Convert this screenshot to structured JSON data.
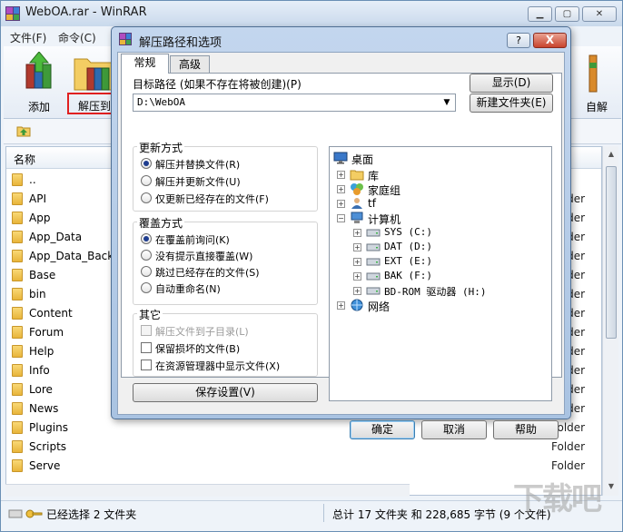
{
  "main_window": {
    "title": "WebOA.rar - WinRAR",
    "menu": [
      "文件(F)",
      "命令(C)"
    ],
    "toolbar": {
      "add_label": "添加",
      "extract_label": "解压到",
      "wizard_label": "自解"
    },
    "columns": {
      "name": "名称"
    },
    "files": [
      {
        "name": "..",
        "type": ""
      },
      {
        "name": "API",
        "type": "Folder"
      },
      {
        "name": "App",
        "type": "Folder"
      },
      {
        "name": "App_Data",
        "type": "Folder"
      },
      {
        "name": "App_Data_Backu",
        "type": "Folder"
      },
      {
        "name": "Base",
        "type": "Folder"
      },
      {
        "name": "bin",
        "type": "Folder"
      },
      {
        "name": "Content",
        "type": "Folder"
      },
      {
        "name": "Forum",
        "type": "Folder"
      },
      {
        "name": "Help",
        "type": "Folder"
      },
      {
        "name": "Info",
        "type": "Folder"
      },
      {
        "name": "Lore",
        "type": "Folder"
      },
      {
        "name": "News",
        "type": "Folder"
      },
      {
        "name": "Plugins",
        "type": "Folder"
      },
      {
        "name": "Scripts",
        "type": "Folder"
      },
      {
        "name": "Serve",
        "type": "Folder"
      }
    ],
    "status": {
      "selected": "已经选择 2 文件夹",
      "total": "总计 17 文件夹 和 228,685 字节 (9 个文件)"
    }
  },
  "dialog": {
    "title": "解压路径和选项",
    "help_button": "?",
    "close_button": "X",
    "tabs": [
      "常规",
      "高级"
    ],
    "target_label": "目标路径 (如果不存在将被创建)(P)",
    "target_value": "D:\\WebOA",
    "show_button": "显示(D)",
    "new_folder_button": "新建文件夹(E)",
    "update_group": {
      "title": "更新方式",
      "options": [
        {
          "label": "解压并替换文件(R)",
          "selected": true
        },
        {
          "label": "解压并更新文件(U)",
          "selected": false
        },
        {
          "label": "仅更新已经存在的文件(F)",
          "selected": false
        }
      ]
    },
    "overwrite_group": {
      "title": "覆盖方式",
      "options": [
        {
          "label": "在覆盖前询问(K)",
          "selected": true
        },
        {
          "label": "没有提示直接覆盖(W)",
          "selected": false
        },
        {
          "label": "跳过已经存在的文件(S)",
          "selected": false
        },
        {
          "label": "自动重命名(N)",
          "selected": false
        }
      ]
    },
    "misc_group": {
      "title": "其它",
      "options": [
        {
          "label": "解压文件到子目录(L)",
          "checked": false,
          "disabled": true
        },
        {
          "label": "保留损坏的文件(B)",
          "checked": false,
          "disabled": false
        },
        {
          "label": "在资源管理器中显示文件(X)",
          "checked": false,
          "disabled": false
        }
      ]
    },
    "save_button": "保存设置(V)",
    "tree": {
      "desktop": "桌面",
      "library": "库",
      "homegroup": "家庭组",
      "user": "tf",
      "computer": "计算机",
      "drives": [
        "SYS (C:)",
        "DAT (D:)",
        "EXT (E:)",
        "BAK (F:)",
        "BD-ROM 驱动器 (H:)"
      ],
      "network": "网络"
    },
    "ok_button": "确定",
    "cancel_button": "取消",
    "help_button_bottom": "帮助"
  },
  "colors": {
    "highlight_red": "#e02020",
    "dialog_frame": "#a9c3e2",
    "close_red": "#c8432d"
  },
  "icons": {
    "add": "books-add-icon",
    "extract": "folder-books-icon",
    "wizard": "wizard-icon",
    "up": "up-folder-icon",
    "folder": "folder-icon",
    "desktop": "desktop-icon",
    "library": "library-icon",
    "homegroup": "homegroup-icon",
    "user": "user-icon",
    "computer": "computer-icon",
    "drive": "drive-icon",
    "network": "network-icon"
  }
}
